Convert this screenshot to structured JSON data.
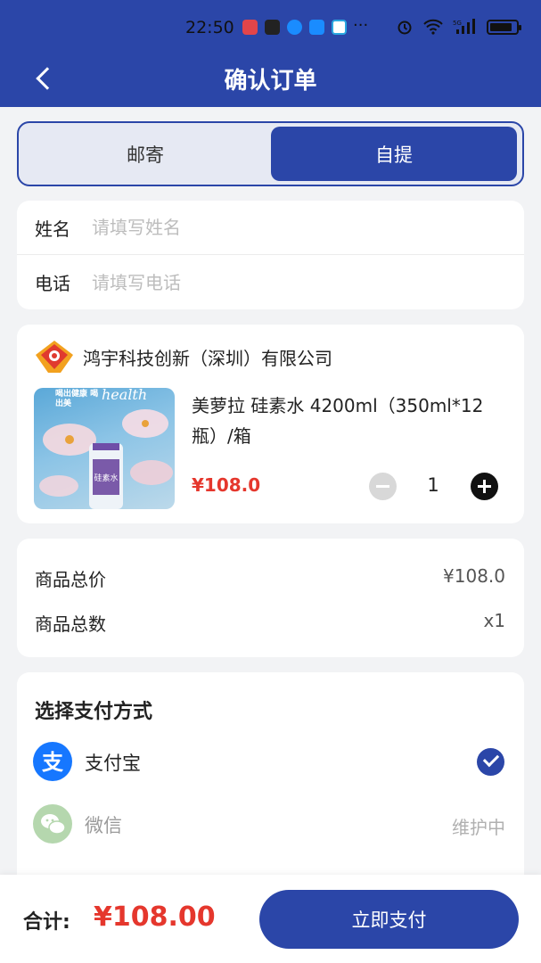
{
  "status_bar": {
    "time": "22:50",
    "more": "···",
    "signal_label": "5G",
    "app_icon_colors": [
      "#e2454a",
      "#222222",
      "#1a8cff",
      "#1a8cff",
      "#2aa7e0"
    ]
  },
  "header": {
    "title": "确认订单",
    "background_color": "#2b46a8"
  },
  "delivery_tabs": {
    "options": [
      "邮寄",
      "自提"
    ],
    "selected": "自提"
  },
  "form": {
    "name_label": "姓名",
    "name_placeholder": "请填写姓名",
    "name_value": "",
    "phone_label": "电话",
    "phone_placeholder": "请填写电话",
    "phone_value": ""
  },
  "product": {
    "company_name": "鸿宇科技创新（深圳）有限公司",
    "title": "美萝拉 硅素水 4200ml（350ml*12瓶）/箱",
    "price": "¥108.0",
    "quantity": "1",
    "image_text_left": "喝出健康 喝出美",
    "image_text_right": "health"
  },
  "summary": {
    "total_price_label": "商品总价",
    "total_price_value": "¥108.0",
    "total_count_label": "商品总数",
    "total_count_value": "x1"
  },
  "payment": {
    "heading": "选择支付方式",
    "methods": [
      {
        "name": "支付宝",
        "icon": "alipay-icon",
        "selected": true,
        "status": ""
      },
      {
        "name": "微信",
        "icon": "wechat-icon",
        "selected": false,
        "status": "维护中"
      }
    ]
  },
  "bottom_bar": {
    "total_label": "合计:",
    "total_value": "¥108.00",
    "pay_button_label": "立即支付"
  },
  "colors": {
    "primary": "#2b46a8",
    "price_red": "#e5372d",
    "alipay_blue": "#1677ff",
    "wechat_green": "#b5d7ae"
  }
}
